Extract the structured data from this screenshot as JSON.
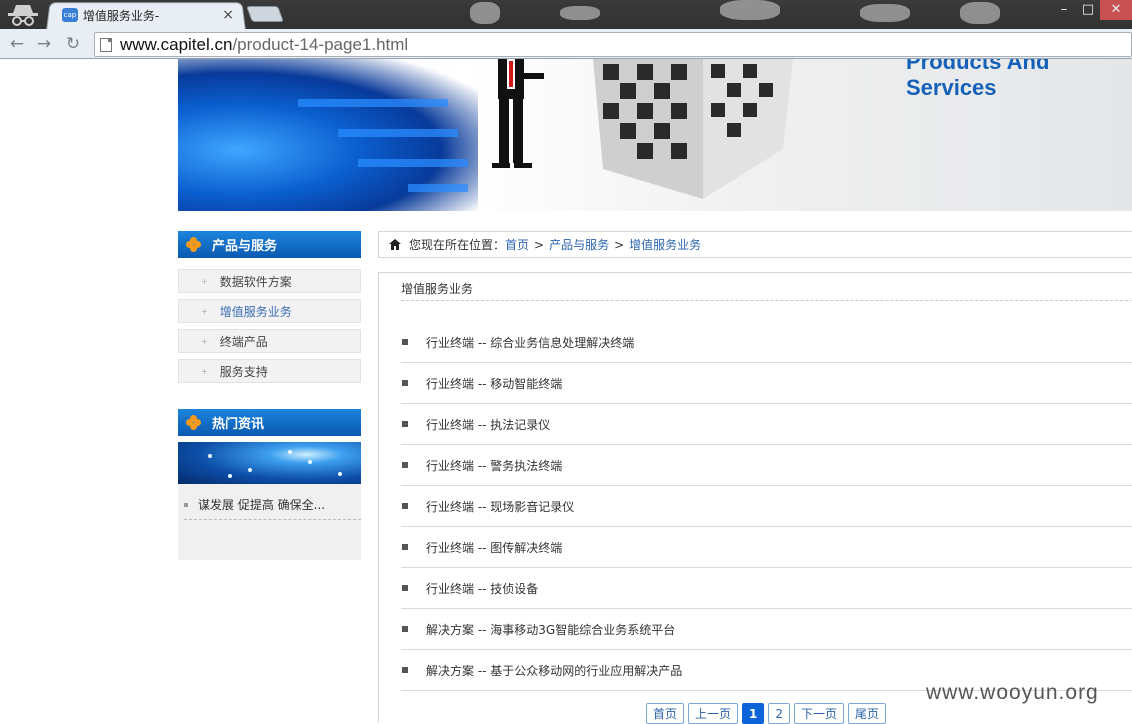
{
  "browser": {
    "tab_title": "增值服务业务-",
    "tab_close": "×",
    "url_host": "www.capitel.cn",
    "url_path": "/product-14-page1.html",
    "nav_back": "←",
    "nav_forward": "→",
    "nav_reload": "↻",
    "win_minimize": "–",
    "win_maximize": "□",
    "win_close": "✕",
    "favicon_text": "cap"
  },
  "banner": {
    "tagline": "Products And Services"
  },
  "sidebar": {
    "products_heading": "产品与服务",
    "items": [
      {
        "label": "数据软件方案"
      },
      {
        "label": "增值服务业务",
        "active": true
      },
      {
        "label": "终端产品"
      },
      {
        "label": "服务支持"
      }
    ],
    "news_heading": "热门资讯",
    "news_items": [
      {
        "label": "谋发展 促提高 确保全..."
      }
    ]
  },
  "breadcrumb": {
    "prefix": "您现在所在位置：",
    "links": [
      "首页",
      "产品与服务",
      "增值服务业务"
    ],
    "separator": ">"
  },
  "main": {
    "section_title": "增值服务业务",
    "items": [
      {
        "label": "行业终端 -- 综合业务信息处理解决终端"
      },
      {
        "label": "行业终端 -- 移动智能终端"
      },
      {
        "label": "行业终端 -- 执法记录仪"
      },
      {
        "label": "行业终端 -- 警务执法终端"
      },
      {
        "label": "行业终端 -- 现场影音记录仪"
      },
      {
        "label": "行业终端 -- 图传解决终端"
      },
      {
        "label": "行业终端 -- 技侦设备"
      },
      {
        "label": "解决方案 -- 海事移动3G智能综合业务系统平台"
      },
      {
        "label": "解决方案 -- 基于公众移动网的行业应用解决产品"
      }
    ]
  },
  "pager": {
    "first": "首页",
    "prev": "上一页",
    "pages": [
      "1",
      "2"
    ],
    "current": "1",
    "next": "下一页",
    "last": "尾页"
  },
  "watermark": "www.wooyun.org",
  "colors": {
    "accent_blue": "#0a59b0",
    "link": "#2b64ad",
    "bullet_orange": "#f79a1c"
  }
}
